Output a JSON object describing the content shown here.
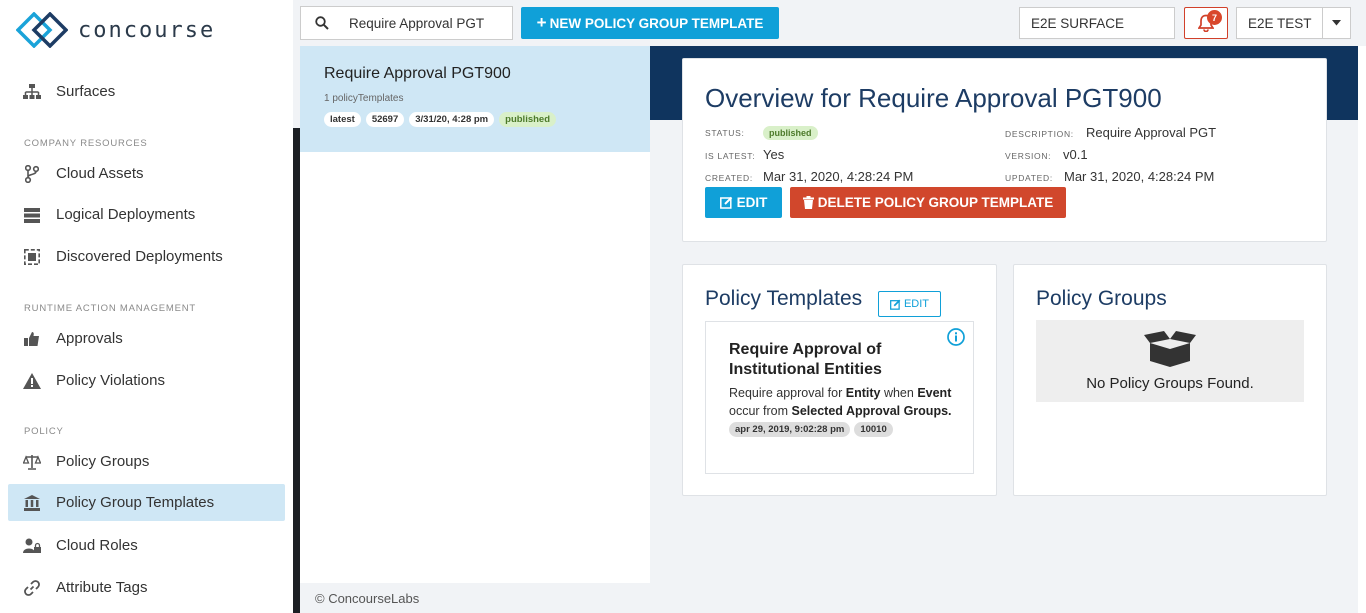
{
  "app": {
    "name": "concourse"
  },
  "sidebar": {
    "surfaces": "Surfaces",
    "sections": [
      {
        "label": "COMPANY RESOURCES"
      },
      {
        "label": "RUNTIME ACTION MANAGEMENT"
      },
      {
        "label": "POLICY"
      }
    ],
    "items": {
      "cloud_assets": "Cloud Assets",
      "logical_deployments": "Logical Deployments",
      "discovered_deployments": "Discovered Deployments",
      "approvals": "Approvals",
      "policy_violations": "Policy Violations",
      "policy_groups": "Policy Groups",
      "policy_group_templates": "Policy Group Templates",
      "cloud_roles": "Cloud Roles",
      "attribute_tags": "Attribute Tags"
    }
  },
  "topbar": {
    "search_value": "Require Approval PGT",
    "new_button": "NEW POLICY GROUP TEMPLATE",
    "surface": "E2E SURFACE",
    "notifications": "7",
    "user": "E2E TEST"
  },
  "list": {
    "item": {
      "title": "Require Approval PGT900",
      "sub": "1 policyTemplates",
      "chips": [
        "latest",
        "52697",
        "3/31/20, 4:28 pm",
        "published"
      ]
    }
  },
  "overview": {
    "title": "Overview for Require Approval PGT900",
    "status_label": "STATUS:",
    "status_value": "published",
    "is_latest_label": "IS LATEST:",
    "is_latest_value": "Yes",
    "created_label": "CREATED:",
    "created_value": "Mar 31, 2020, 4:28:24 PM",
    "description_label": "DESCRIPTION:",
    "description_value": "Require Approval PGT",
    "version_label": "VERSION:",
    "version_value": "v0.1",
    "updated_label": "UPDATED:",
    "updated_value": "Mar 31, 2020, 4:28:24 PM",
    "edit_button": "EDIT",
    "delete_button": "DELETE POLICY GROUP TEMPLATE"
  },
  "policy_templates": {
    "title": "Policy Templates",
    "edit_button": "EDIT",
    "card": {
      "name": "Require Approval of Institutional Entities",
      "desc_1": "Require approval for ",
      "desc_entity": "Entity",
      "desc_2": " when ",
      "desc_event": "Event",
      "desc_3": " occur from ",
      "desc_groups": "Selected Approval Groups.",
      "chips": [
        "apr 29, 2019, 9:02:28 pm",
        "10010"
      ]
    }
  },
  "policy_groups": {
    "title": "Policy Groups",
    "empty": "No Policy Groups Found."
  },
  "footer": "© ConcourseLabs",
  "colors": {
    "accent": "#10a0d8",
    "navy": "#0f345e",
    "danger": "#d1472c",
    "active_bg": "#cfe7f5"
  }
}
